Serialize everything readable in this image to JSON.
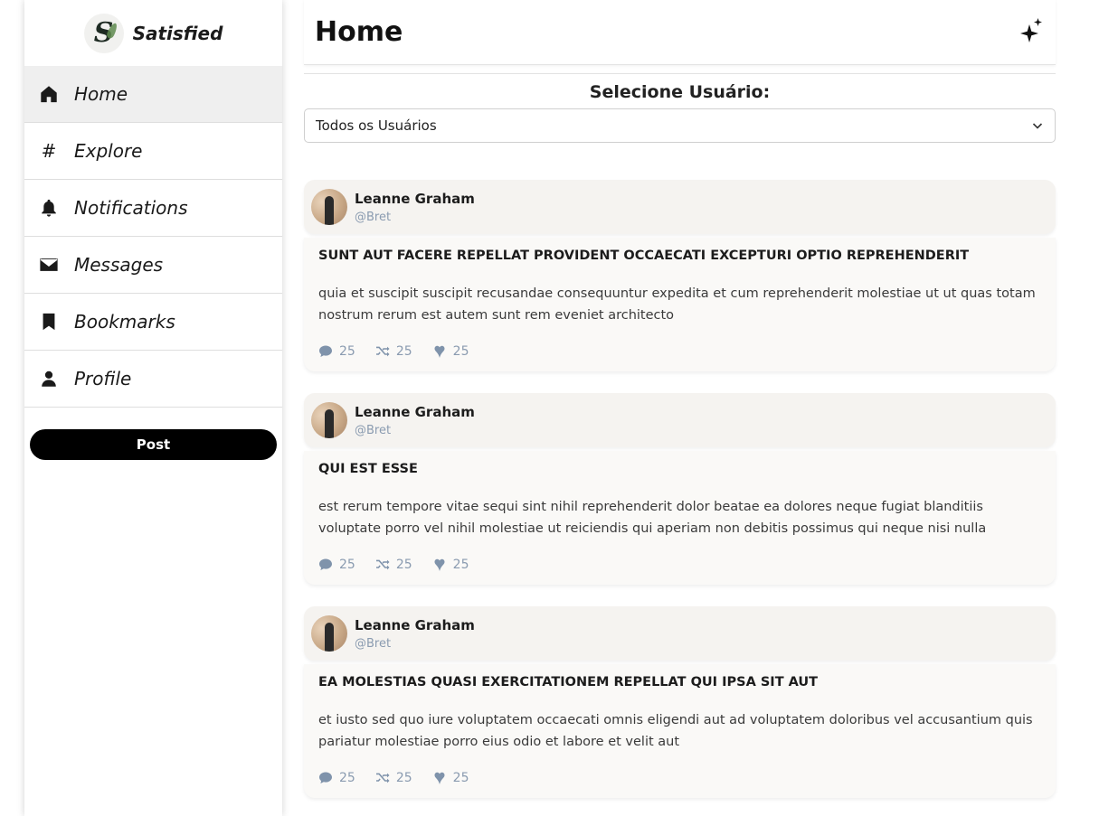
{
  "brand": {
    "name": "Satisfied",
    "logo_letter": "S"
  },
  "sidebar": {
    "items": [
      {
        "label": "Home",
        "icon": "home-icon",
        "active": true
      },
      {
        "label": "Explore",
        "icon": "hash-icon"
      },
      {
        "label": "Notifications",
        "icon": "bell-icon"
      },
      {
        "label": "Messages",
        "icon": "envelope-icon"
      },
      {
        "label": "Bookmarks",
        "icon": "bookmark-icon"
      },
      {
        "label": "Profile",
        "icon": "user-icon"
      }
    ],
    "post_button": "Post"
  },
  "header": {
    "title": "Home",
    "icon": "sparkles-icon"
  },
  "user_select": {
    "label": "Selecione Usuário:",
    "value": "Todos os Usuários"
  },
  "posts": [
    {
      "author": "Leanne Graham",
      "handle": "@Bret",
      "title": "SUNT AUT FACERE REPELLAT PROVIDENT OCCAECATI EXCEPTURI OPTIO REPREHENDERIT",
      "body": "quia et suscipit suscipit recusandae consequuntur expedita et cum reprehenderit molestiae ut ut quas totam nostrum rerum est autem sunt rem eveniet architecto",
      "comments": "25",
      "retweets": "25",
      "likes": "25"
    },
    {
      "author": "Leanne Graham",
      "handle": "@Bret",
      "title": "QUI EST ESSE",
      "body": "est rerum tempore vitae sequi sint nihil reprehenderit dolor beatae ea dolores neque fugiat blanditiis voluptate porro vel nihil molestiae ut reiciendis qui aperiam non debitis possimus qui neque nisi nulla",
      "comments": "25",
      "retweets": "25",
      "likes": "25"
    },
    {
      "author": "Leanne Graham",
      "handle": "@Bret",
      "title": "EA MOLESTIAS QUASI EXERCITATIONEM REPELLAT QUI IPSA SIT AUT",
      "body": "et iusto sed quo iure voluptatem occaecati omnis eligendi aut ad voluptatem doloribus vel accusantium quis pariatur molestiae porro eius odio et labore et velit aut",
      "comments": "25",
      "retweets": "25",
      "likes": "25"
    }
  ],
  "colors": {
    "accent": "#000000",
    "muted": "#8a9bb0",
    "card_head": "#f5f3f0",
    "card_body": "#faf9f7"
  }
}
